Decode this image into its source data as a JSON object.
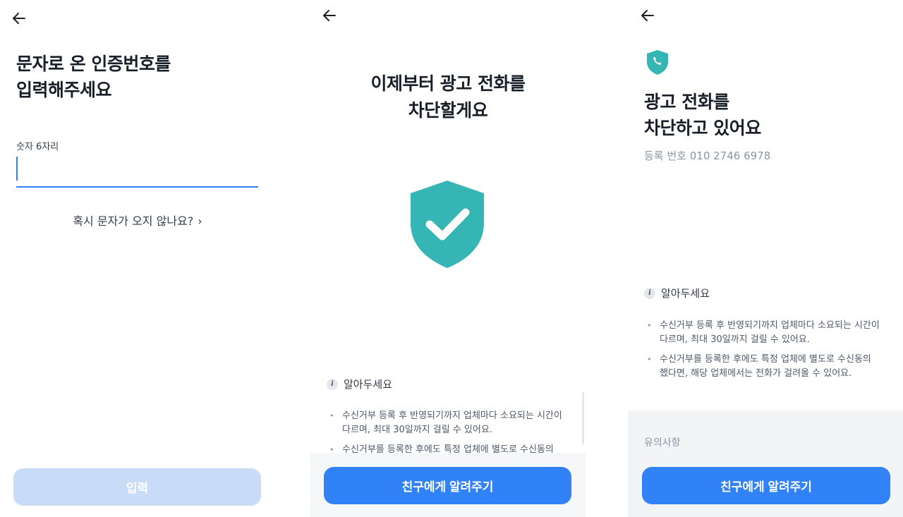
{
  "screen1": {
    "title_line1": "문자로 온 인증번호를",
    "title_line2": "입력해주세요",
    "input_label": "숫자 6자리",
    "input_value": "",
    "resend_link": "혹시 문자가 오지 않나요?",
    "submit_button": "입력"
  },
  "screen2": {
    "title_line1": "이제부터 광고 전화를",
    "title_line2": "차단할게요",
    "notice_title": "알아두세요",
    "notice_items": [
      "수신거부 등록 후 반영되기까지 업체마다 소요되는 시간이 다르며, 최대 30일까지 걸릴 수 있어요.",
      "수신거부를 등록한 후에도 특정 업체에 별도로 수신동의"
    ],
    "share_button": "친구에게 알려주기"
  },
  "screen3": {
    "title_line1": "광고 전화를",
    "title_line2": "차단하고 있어요",
    "registered_number": "등록 번호 010 2746 6978",
    "notice_title": "알아두세요",
    "notice_items": [
      "수신거부 등록 후 반영되기까지 업체마다 소요되는 시간이 다르며, 최대 30일까지 걸릴 수 있어요.",
      "수신거부를 등록한 후에도 특정 업체에 별도로 수신동의 했다면, 해당 업체에서는 전화가 걸려올 수 있어요."
    ],
    "caution_title": "유의사항",
    "share_button": "친구에게 알려주기"
  },
  "colors": {
    "primary": "#3182f6",
    "primary_disabled": "#c9dcf7",
    "shield": "#35b5b3",
    "text": "#191f28",
    "subtext": "#8b95a1"
  },
  "icons": {
    "back": "arrow-left-icon",
    "shield": "shield-check-icon",
    "phone_shield": "shield-phone-icon",
    "info": "info-icon",
    "chevron": "chevron-right-icon"
  }
}
